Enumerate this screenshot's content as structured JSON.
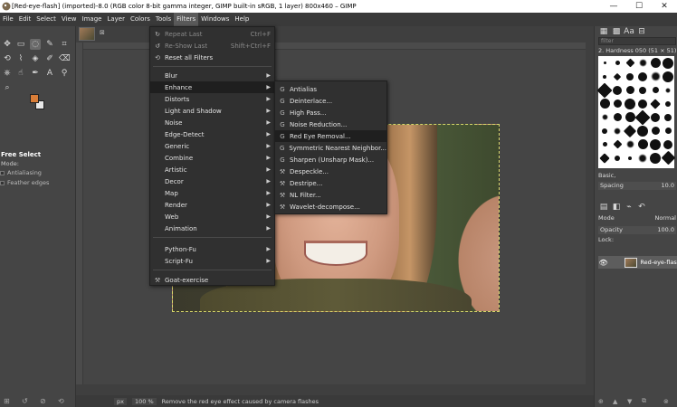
{
  "window": {
    "title": "[Red-eye-flash] (imported)-8.0 (RGB color 8-bit gamma integer, GIMP built-in sRGB, 1 layer) 800x460 – GIMP",
    "minimize": "—",
    "maximize": "☐",
    "close": "✕"
  },
  "menubar": [
    "File",
    "Edit",
    "Select",
    "View",
    "Image",
    "Layer",
    "Colors",
    "Tools",
    "Filters",
    "Windows",
    "Help"
  ],
  "filters_menu": {
    "items": [
      {
        "label": "Repeat Last",
        "shortcut": "Ctrl+F",
        "disabled": true,
        "icon": "repeat-icon"
      },
      {
        "label": "Re-Show Last",
        "shortcut": "Shift+Ctrl+F",
        "disabled": true,
        "icon": "reshow-icon"
      },
      {
        "label": "Reset all Filters",
        "shortcut": "",
        "disabled": false,
        "icon": "reset-icon"
      },
      {
        "label": "Blur",
        "submenu": true
      },
      {
        "label": "Enhance",
        "submenu": true,
        "highlighted": true
      },
      {
        "label": "Distorts",
        "submenu": true
      },
      {
        "label": "Light and Shadow",
        "submenu": true
      },
      {
        "label": "Noise",
        "submenu": true
      },
      {
        "label": "Edge-Detect",
        "submenu": true
      },
      {
        "label": "Generic",
        "submenu": true
      },
      {
        "label": "Combine",
        "submenu": true
      },
      {
        "label": "Artistic",
        "submenu": true
      },
      {
        "label": "Decor",
        "submenu": true
      },
      {
        "label": "Map",
        "submenu": true
      },
      {
        "label": "Render",
        "submenu": true
      },
      {
        "label": "Web",
        "submenu": true
      },
      {
        "label": "Animation",
        "submenu": true
      },
      {
        "label": "Python-Fu",
        "submenu": true
      },
      {
        "label": "Script-Fu",
        "submenu": true
      },
      {
        "label": "Goat-exercise",
        "icon": "goat-icon"
      }
    ]
  },
  "enhance_menu": {
    "items": [
      {
        "label": "Antialias"
      },
      {
        "label": "Deinterlace..."
      },
      {
        "label": "High Pass..."
      },
      {
        "label": "Noise Reduction..."
      },
      {
        "label": "Red Eye Removal...",
        "highlighted": true
      },
      {
        "label": "Symmetric Nearest Neighbor..."
      },
      {
        "label": "Sharpen (Unsharp Mask)..."
      },
      {
        "label": "Despeckle..."
      },
      {
        "label": "Destripe..."
      },
      {
        "label": "NL Filter..."
      },
      {
        "label": "Wavelet-decompose..."
      }
    ]
  },
  "tool_options": {
    "title": "Free Select",
    "mode_label": "Mode:",
    "antialiasing": "Antialiasing",
    "feather_edges": "Feather edges"
  },
  "image_tab": {
    "close": "⊠"
  },
  "statusbar": {
    "unit": "px",
    "zoom": "100 %",
    "message": "Remove the red eye effect caused by camera flashes"
  },
  "brushes": {
    "filter_placeholder": "filter",
    "current": "2. Hardness 050 (51 × 51)",
    "preset": "Basic,",
    "spacing_label": "Spacing",
    "spacing_value": "10.0"
  },
  "layers": {
    "mode_label": "Mode",
    "mode_value": "Normal",
    "opacity_label": "Opacity",
    "opacity_value": "100.0",
    "lock_label": "Lock:",
    "layer_name": "Red-eye-flash"
  },
  "colors": {
    "foreground": "#d87d38",
    "background": "#e8e8e8",
    "menu_bg": "#303030",
    "highlight": "#1f1f1f"
  }
}
